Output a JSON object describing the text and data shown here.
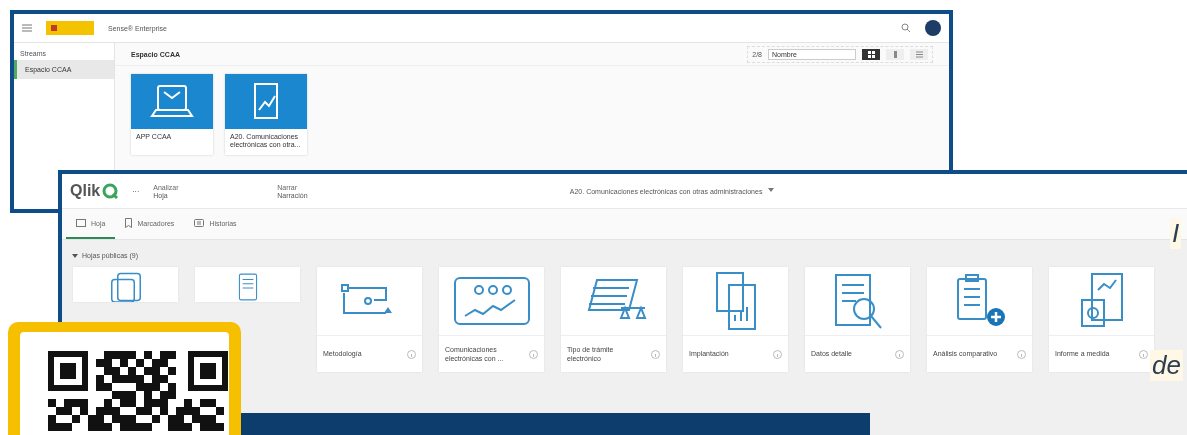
{
  "back_window": {
    "app_name": "Sense® Enterprise",
    "sidebar": {
      "heading": "Streams",
      "items": [
        {
          "label": "Espacio CCAA",
          "selected": true
        }
      ]
    },
    "stream_title": "Espacio CCAA",
    "toolbar": {
      "count": "2/8",
      "sort": "Nombre",
      "views": [
        {
          "kind": "grid",
          "selected": true
        },
        {
          "kind": "tall",
          "selected": false
        },
        {
          "kind": "list",
          "selected": false
        }
      ]
    },
    "apps": [
      {
        "kind": "laptop",
        "label": "APP CCAA"
      },
      {
        "kind": "report",
        "label": "A20. Comunicaciones electrónicas con otra..."
      }
    ]
  },
  "front_window": {
    "logo": "Qlik",
    "more": "···",
    "modes": [
      {
        "caption": "Analizar",
        "value": "Hoja"
      },
      {
        "caption": "Narrar",
        "value": "Narración"
      }
    ],
    "app_title": "A20. Comunicaciones electrónicas con otras administraciones",
    "tabs": [
      {
        "kind": "sheet",
        "label": "Hoja",
        "selected": true
      },
      {
        "kind": "bookmark",
        "label": "Marcadores",
        "selected": false
      },
      {
        "kind": "story",
        "label": "Historias",
        "selected": false
      }
    ],
    "section": {
      "title": "Hojas públicas (9)",
      "expanded": true
    },
    "sheets": [
      {
        "kind": "folders"
      },
      {
        "kind": "scroll"
      },
      {
        "kind": "flow",
        "label": "Metodología"
      },
      {
        "kind": "tablet",
        "label": "Comunicaciones electrónicas con ..."
      },
      {
        "kind": "balance",
        "label": "Tipo de trámite electrónico"
      },
      {
        "kind": "docs",
        "label": "Implantación"
      },
      {
        "kind": "magnifier",
        "label": "Datos detalle"
      },
      {
        "kind": "clipboard",
        "label": "Análisis comparativo"
      },
      {
        "kind": "report",
        "label": "Informe a medida"
      }
    ]
  },
  "slide_text": [
    "I",
    "de"
  ]
}
